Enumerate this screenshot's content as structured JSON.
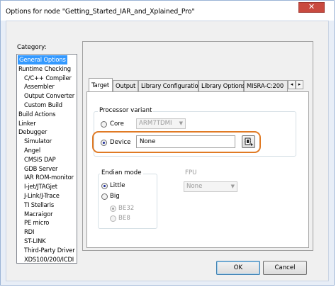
{
  "window": {
    "title": "Options for node \"Getting_Started_IAR_and_Xplained_Pro\"",
    "close_symbol": "✕"
  },
  "category": {
    "label": "Category:",
    "items": [
      {
        "label": "General Options",
        "selected": true
      },
      {
        "label": "Runtime Checking"
      },
      {
        "label": "C/C++ Compiler"
      },
      {
        "label": "Assembler"
      },
      {
        "label": "Output Converter"
      },
      {
        "label": "Custom Build"
      },
      {
        "label": "Build Actions"
      },
      {
        "label": "Linker"
      },
      {
        "label": "Debugger"
      },
      {
        "label": "Simulator"
      },
      {
        "label": "Angel"
      },
      {
        "label": "CMSIS DAP"
      },
      {
        "label": "GDB Server"
      },
      {
        "label": "IAR ROM-monitor"
      },
      {
        "label": "I-jet/JTAGjet"
      },
      {
        "label": "J-Link/J-Trace"
      },
      {
        "label": "TI Stellaris"
      },
      {
        "label": "Macraigor"
      },
      {
        "label": "PE micro"
      },
      {
        "label": "RDI"
      },
      {
        "label": "ST-LINK"
      },
      {
        "label": "Third-Party Driver"
      },
      {
        "label": "XDS100/200/ICDI"
      }
    ]
  },
  "tabs": [
    "Target",
    "Output",
    "Library Configuration",
    "Library Options",
    "MISRA-C:200"
  ],
  "tab_scroll": {
    "left": "◂",
    "right": "▸"
  },
  "processor_variant": {
    "title": "Processor variant",
    "core_label": "Core",
    "core_value": "ARM7TDMI",
    "device_label": "Device",
    "device_value": "None",
    "device_button_icon": "device-select-icon"
  },
  "endian_mode": {
    "title": "Endian mode",
    "little": "Little",
    "big": "Big",
    "be32": "BE32",
    "be8": "BE8",
    "selected": "Little"
  },
  "fpu": {
    "title": "FPU",
    "value": "None"
  },
  "buttons": {
    "ok": "OK",
    "cancel": "Cancel"
  },
  "colors": {
    "selection": "#3399ff",
    "highlight_border": "#e07a24",
    "close_button": "#c94a3f"
  }
}
